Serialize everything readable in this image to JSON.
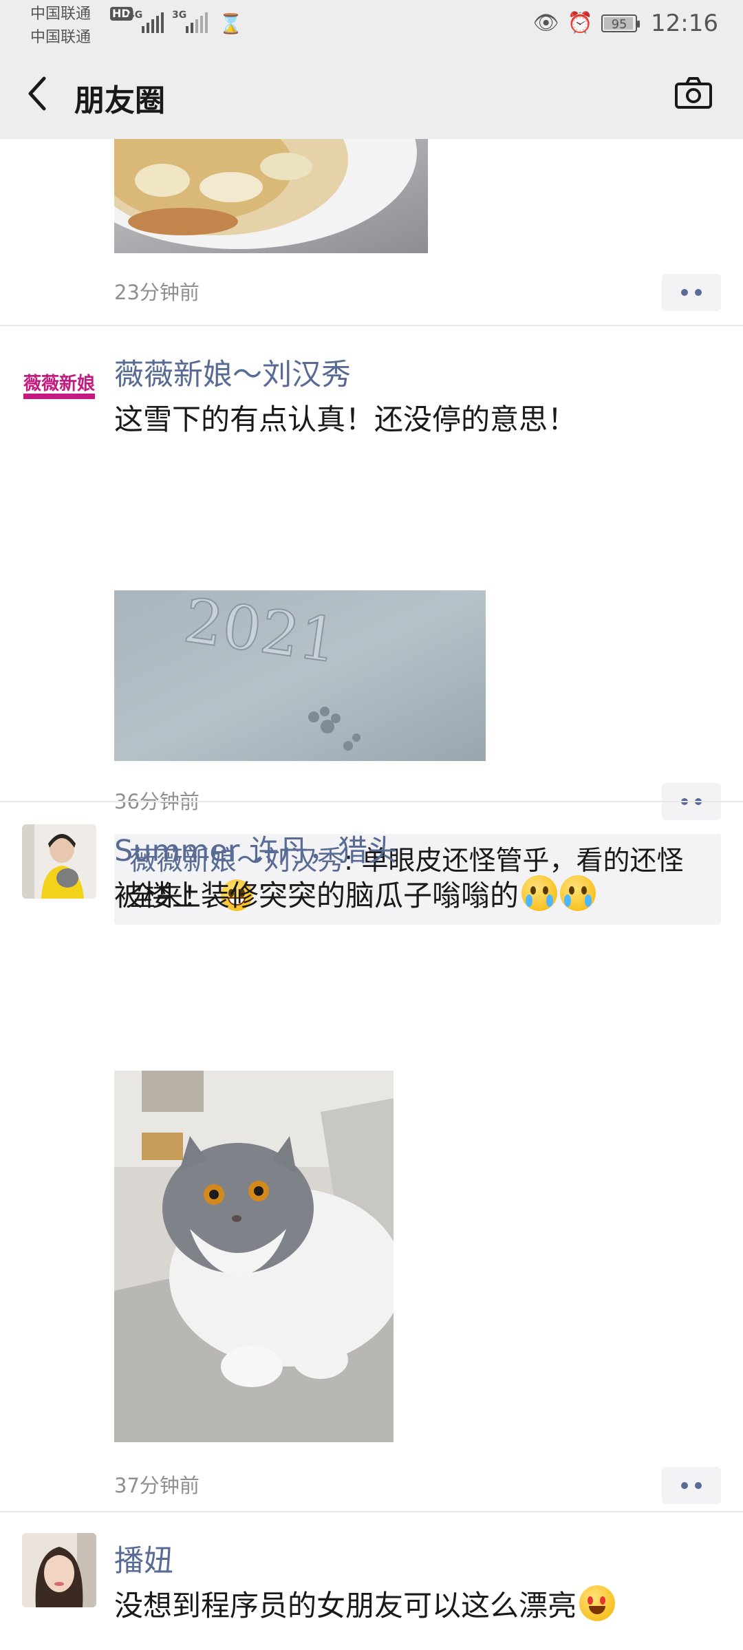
{
  "status_bar": {
    "carrier1": "中国联通",
    "hd_badge": "HD",
    "net1": "4G",
    "carrier2": "中国联通",
    "net2": "3G",
    "battery": "95",
    "time": "12:16"
  },
  "header": {
    "title": "朋友圈"
  },
  "posts": [
    {
      "time": "23分钟前"
    },
    {
      "nickname": "薇薇新娘～刘汉秀",
      "avatar_text": "薇薇新娘",
      "text": "这雪下的有点认真！还没停的意思！",
      "photo_caption": "2021",
      "time": "36分钟前",
      "comment": {
        "author": "薇薇新娘～刘汉秀",
        "text": ": 单眼皮还怪管乎，看的还怪全来！"
      }
    },
    {
      "nickname": "Summer  许丹，猎头",
      "text": "被楼上装修突突的脑瓜子嗡嗡的",
      "time": "37分钟前"
    },
    {
      "nickname": "播妞",
      "text": "没想到程序员的女朋友可以这么漂亮"
    }
  ],
  "colors": {
    "nickname": "#576b95",
    "topbar": "#ededed",
    "time": "#8f8f8f"
  }
}
